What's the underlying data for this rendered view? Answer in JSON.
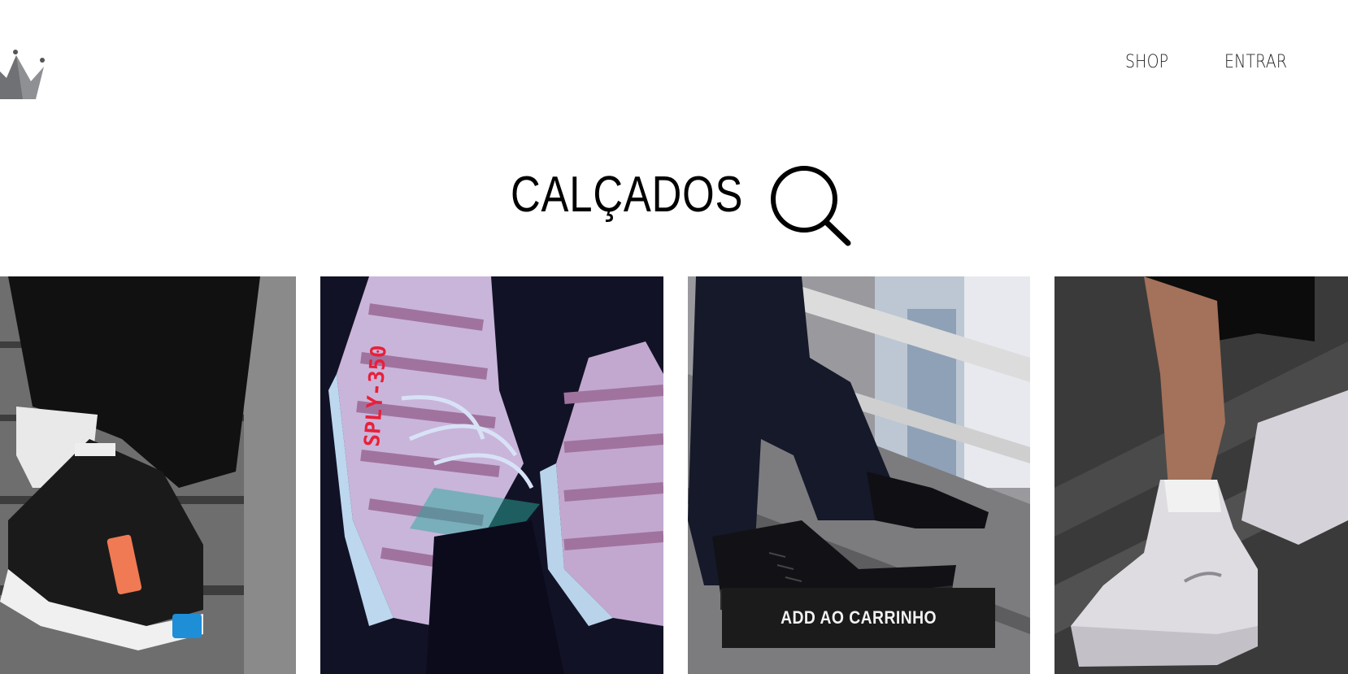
{
  "header": {
    "logo_icon": "crown-icon",
    "nav": [
      {
        "label": "SHOP"
      },
      {
        "label": "ENTRAR"
      }
    ]
  },
  "main": {
    "title": "CALÇADOS",
    "search_icon": "search-icon",
    "products": [
      {
        "image": "black-sneaker-orange-blue-accents"
      },
      {
        "image": "lilac-knit-sneakers-red-lettering",
        "lettering": "SPLY-350"
      },
      {
        "image": "black-high-top-sneakers-on-stairs",
        "add_to_cart_label": "ADD AO CARRINHO"
      },
      {
        "image": "white-high-top-sneakers-on-stairs"
      }
    ]
  },
  "colors": {
    "background": "#ffffff",
    "text": "#000000",
    "button_bg": "#1b1b1b",
    "button_text": "#f2f2f2",
    "logo_gray": "#808285"
  }
}
